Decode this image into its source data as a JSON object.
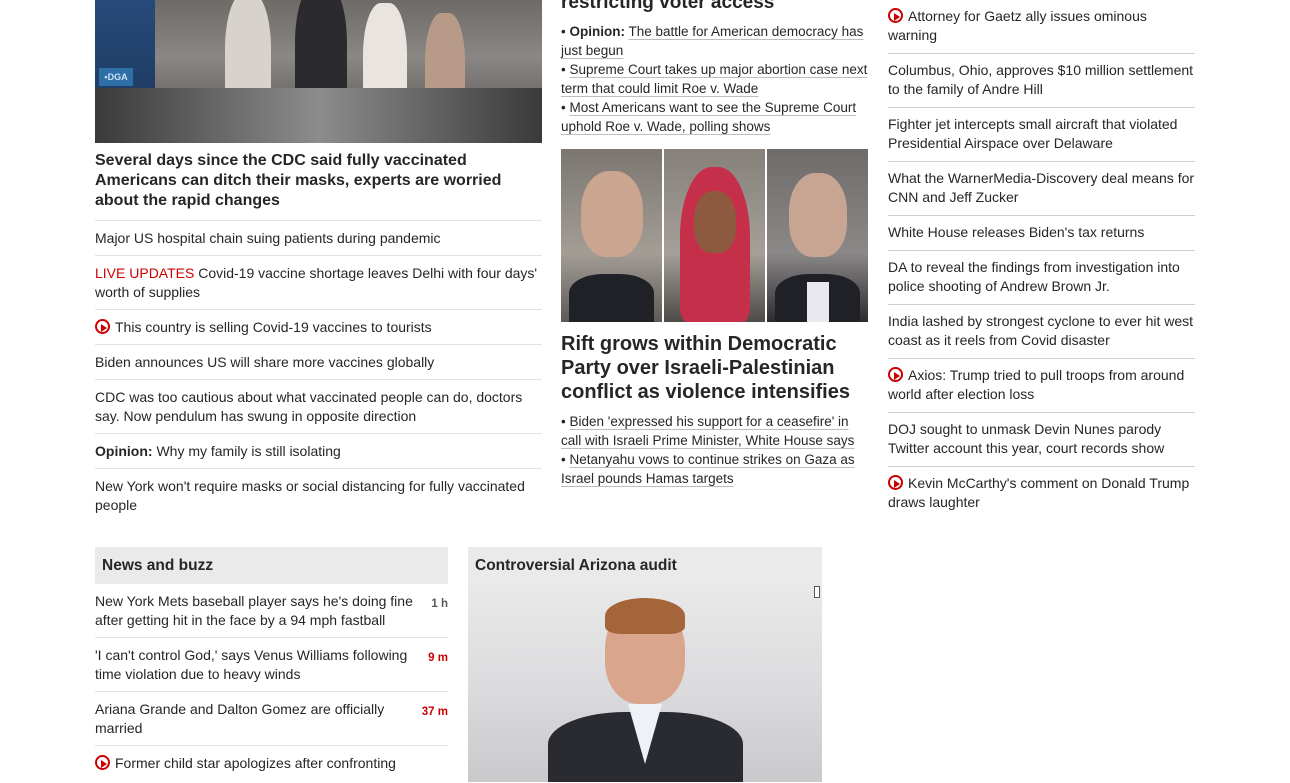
{
  "col1": {
    "headline": "Several days since the CDC said fully vaccinated Americans can ditch their masks, experts are worried about the rapid changes",
    "items": [
      {
        "text": "Major US hospital chain suing patients during pandemic"
      },
      {
        "prefix": "LIVE UPDATES",
        "text": "Covid-19 vaccine shortage leaves Delhi with four days' worth of supplies"
      },
      {
        "text": "This country is selling Covid-19 vaccines to tourists"
      },
      {
        "text": "Biden announces US will share more vaccines globally"
      },
      {
        "text": "CDC was too cautious about what vaccinated people can do, doctors say. Now pendulum has swung in opposite direction"
      },
      {
        "prefix": "Opinion:",
        "text": "Why my family is still isolating"
      },
      {
        "text": "New York won't require masks or social distancing for fully vaccinated people"
      }
    ]
  },
  "col2": {
    "top_headline": "restricting voter access",
    "top_bullets": [
      {
        "prefix": "Opinion:",
        "text": "The battle for American democracy has just begun"
      },
      {
        "text": "Supreme Court takes up major abortion case next term that could limit Roe v. Wade"
      },
      {
        "text": "Most Americans want to see the Supreme Court uphold Roe v. Wade, polling shows"
      }
    ],
    "headline": "Rift grows within Democratic Party over Israeli-Palestinian conflict as violence intensifies",
    "bullets": [
      {
        "text": "Biden 'expressed his support for a ceasefire' in call with Israeli Prime Minister, White House says"
      },
      {
        "text": "Netanyahu vows to continue strikes on Gaza as Israel pounds Hamas targets"
      }
    ]
  },
  "col3": {
    "items": [
      {
        "text": "Attorney for Gaetz ally issues ominous warning"
      },
      {
        "text": "Columbus, Ohio, approves $10 million settlement to the family of Andre Hill"
      },
      {
        "text": "Fighter jet intercepts small aircraft that violated Presidential Airspace over Delaware"
      },
      {
        "text": "What the WarnerMedia-Discovery deal means for CNN and Jeff Zucker"
      },
      {
        "text": "White House releases Biden's tax returns"
      },
      {
        "text": "DA to reveal the findings from investigation into police shooting of Andrew Brown Jr."
      },
      {
        "text": "India lashed by strongest cyclone to ever hit west coast as it reels from Covid disaster"
      },
      {
        "text": "Axios: Trump tried to pull troops from around world after election loss"
      },
      {
        "text": "DOJ sought to unmask Devin Nunes parody Twitter account this year, court records show"
      },
      {
        "text": "Kevin McCarthy's comment on Donald Trump draws laughter"
      }
    ]
  },
  "buzz": {
    "title": "News and buzz",
    "items": [
      {
        "text": "New York Mets baseball player says he's doing fine after getting hit in the face by a 94 mph fastball",
        "time": "1 h"
      },
      {
        "text": "'I can't control God,' says Venus Williams following time violation due to heavy winds",
        "time": "9 m"
      },
      {
        "text": "Ariana Grande and Dalton Gomez are officially married",
        "time": "37 m"
      },
      {
        "text": "Former child star apologizes after confronting"
      }
    ]
  },
  "audit": {
    "title": "Controversial Arizona audit"
  },
  "colors": {
    "accent_red": "#cc0000",
    "text": "#262626",
    "section_bg": "#eaeaea"
  }
}
